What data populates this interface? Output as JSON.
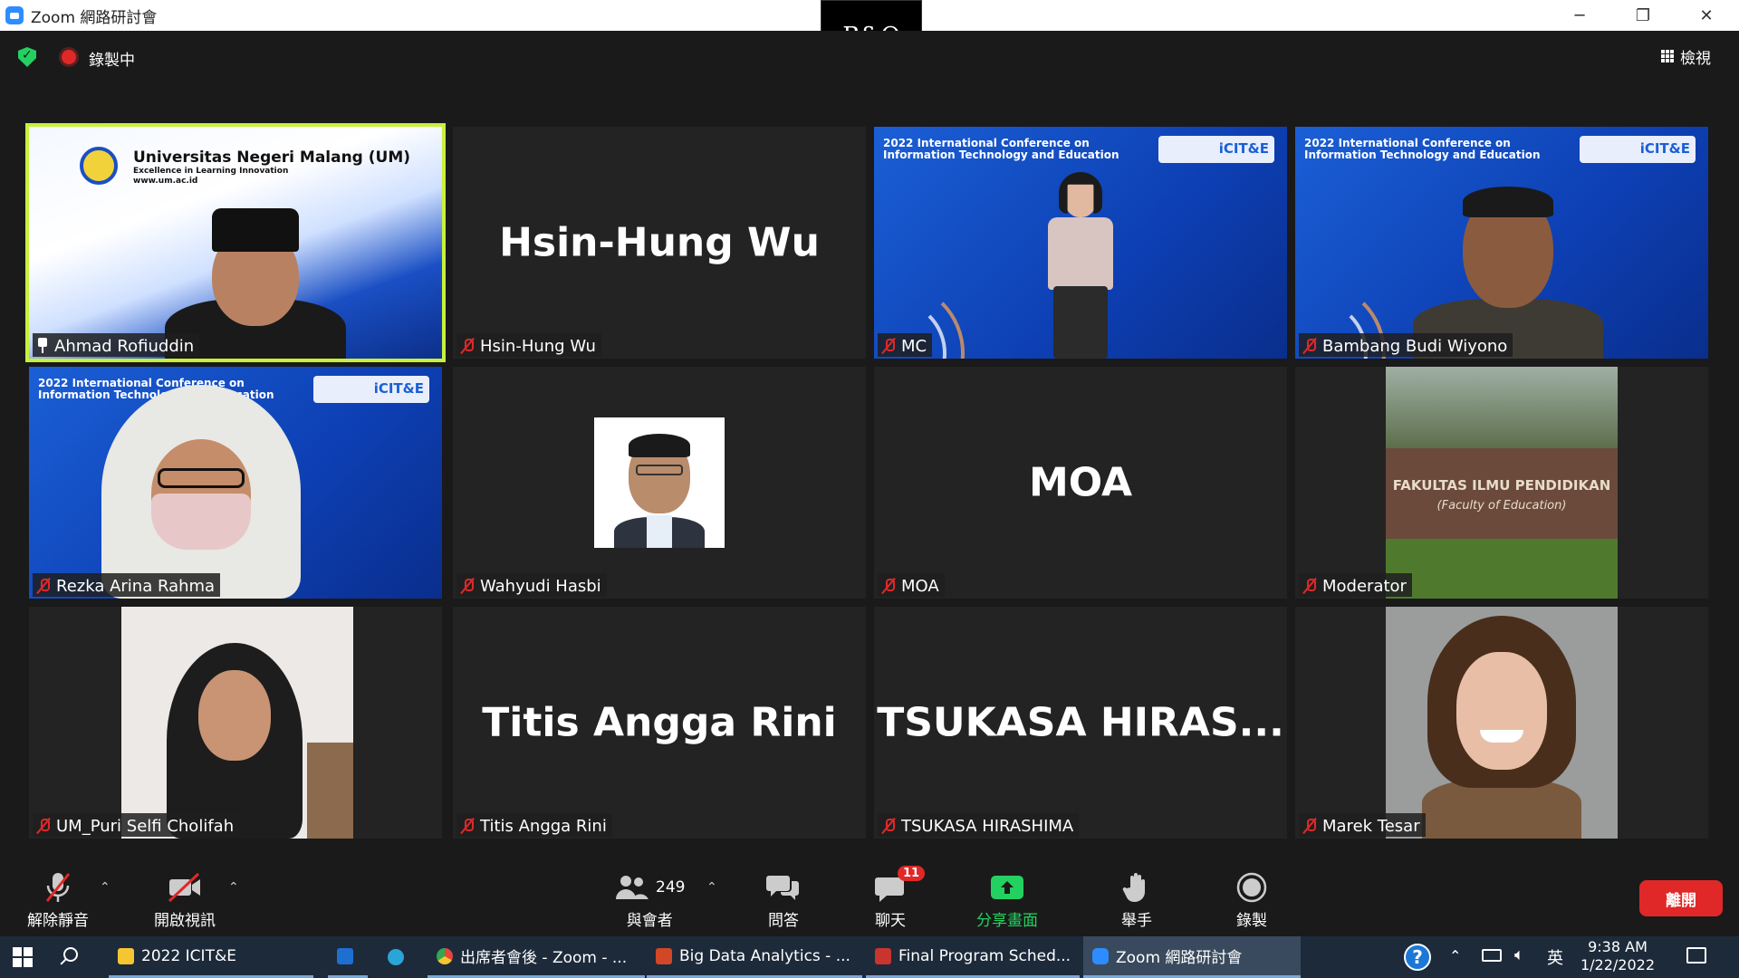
{
  "window": {
    "title": "Zoom 網路研討會",
    "minimize": "─",
    "maximize": "❐",
    "close": "✕"
  },
  "branding": {
    "bo_logo": "B&O"
  },
  "status": {
    "recording_label": "錄製中",
    "view_label": "檢視"
  },
  "tiles": [
    {
      "name": "Ahmad Rofiuddin",
      "kind": "video",
      "active": true,
      "pinned": true,
      "muted": false
    },
    {
      "name": "Hsin-Hung Wu",
      "display_name": "Hsin-Hung Wu",
      "kind": "name",
      "muted": true
    },
    {
      "name": "MC",
      "kind": "video",
      "muted": true
    },
    {
      "name": "Bambang Budi Wiyono",
      "kind": "video",
      "muted": true
    },
    {
      "name": "Rezka Arina Rahma",
      "kind": "video",
      "muted": true
    },
    {
      "name": "Wahyudi Hasbi",
      "kind": "photo",
      "muted": true
    },
    {
      "name": "MOA",
      "display_name": "MOA",
      "kind": "name",
      "muted": true
    },
    {
      "name": "Moderator",
      "kind": "photo",
      "muted": true
    },
    {
      "name": "UM_Puri Selfi Cholifah",
      "kind": "photo",
      "muted": true
    },
    {
      "name": "Titis Angga Rini",
      "display_name": "Titis Angga Rini",
      "kind": "name",
      "muted": true
    },
    {
      "name": "TSUKASA HIRASHIMA",
      "display_name": "TSUKASA  HIRAS...",
      "kind": "name",
      "muted": true
    },
    {
      "name": "Marek Tesar",
      "kind": "photo",
      "muted": true
    }
  ],
  "backgrounds": {
    "um_title": "Universitas Negeri Malang (UM)",
    "um_tagline": "Excellence in Learning Innovation",
    "um_url": "www.um.ac.id",
    "conf_title_1": "2022 International Conference on",
    "conf_title_2": "Information Technology and Education",
    "faculty_sign_1": "FAKULTAS ILMU PENDIDIKAN",
    "faculty_sign_2": "(Faculty of Education)"
  },
  "toolbar": {
    "unmute": "解除靜音",
    "start_video": "開啟視訊",
    "participants": "與會者",
    "participants_count": "249",
    "qa": "問答",
    "chat": "聊天",
    "chat_badge": "11",
    "share": "分享畫面",
    "raise_hand": "舉手",
    "record": "錄製",
    "leave": "離開"
  },
  "taskbar": {
    "apps": [
      {
        "label": "2022 ICIT&E",
        "icon": "folder-icon",
        "color": "#f6c532"
      },
      {
        "label": "",
        "icon": "outlook-icon",
        "color": "#1f6fd1"
      },
      {
        "label": "",
        "icon": "edge-icon",
        "color": "#2aa5d8"
      },
      {
        "label": "出席者會後 - Zoom - ...",
        "icon": "chrome-icon",
        "color": "#e8453c"
      },
      {
        "label": "Big Data Analytics - ...",
        "icon": "powerpoint-icon",
        "color": "#d24726"
      },
      {
        "label": "Final Program Sched...",
        "icon": "pdf-icon",
        "color": "#c9342f"
      },
      {
        "label": "Zoom 網路研討會",
        "icon": "zoom-icon",
        "color": "#2d8cff"
      }
    ],
    "ime": "英",
    "time": "9:38 AM",
    "date": "1/22/2022"
  }
}
